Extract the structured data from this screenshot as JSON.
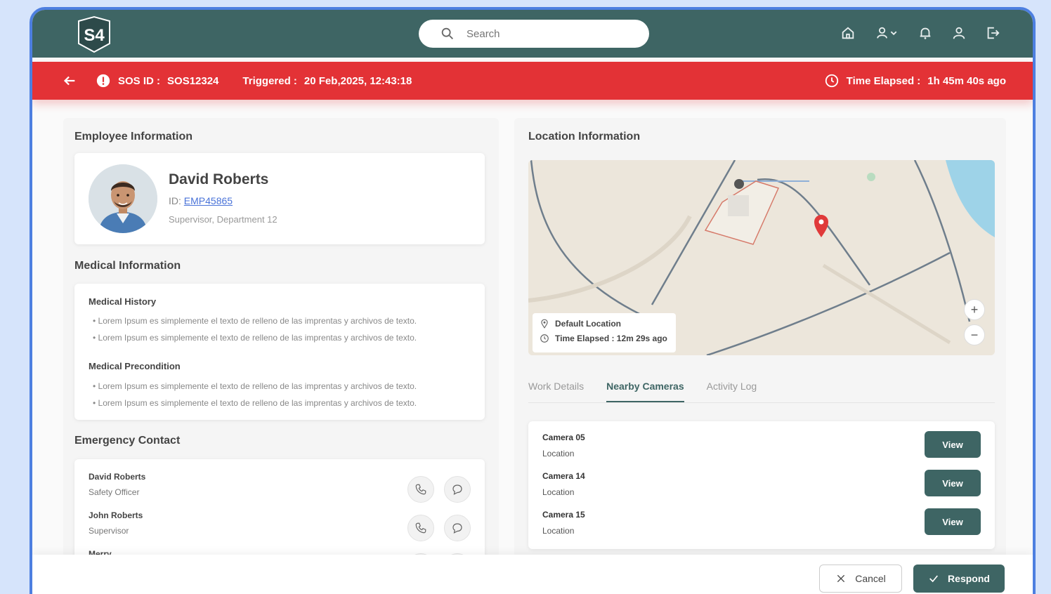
{
  "header": {
    "logo_text": "S4",
    "search_placeholder": "Search",
    "icons": [
      "home-icon",
      "users-dropdown-icon",
      "bell-icon",
      "user-icon",
      "logout-icon"
    ]
  },
  "sos": {
    "id_label": "SOS ID :",
    "id_value": "SOS12324",
    "triggered_label": "Triggered :",
    "triggered_value": "20 Feb,2025, 12:43:18",
    "elapsed_label": "Time Elapsed :",
    "elapsed_value": "1h 45m 40s ago"
  },
  "employee": {
    "section_title": "Employee Information",
    "name": "David Roberts",
    "id_prefix": "ID:",
    "id_value": "EMP45865",
    "role": "Supervisor, Department 12"
  },
  "medical": {
    "section_title": "Medical Information",
    "history_title": "Medical History",
    "history_items": [
      "Lorem Ipsum es simplemente el texto de relleno de las imprentas y archivos de texto.",
      "Lorem Ipsum es simplemente el texto de relleno de las imprentas y archivos de texto."
    ],
    "precondition_title": "Medical Precondition",
    "precondition_items": [
      "Lorem Ipsum es simplemente el texto de relleno de las imprentas y archivos de texto.",
      "Lorem Ipsum es simplemente el texto de relleno de las imprentas y archivos de texto."
    ]
  },
  "emergency": {
    "section_title": "Emergency Contact",
    "contacts": [
      {
        "name": "David Roberts",
        "role": "Safety Officer"
      },
      {
        "name": "John Roberts",
        "role": "Supervisor"
      },
      {
        "name": "Merry",
        "role": ""
      }
    ]
  },
  "location": {
    "section_title": "Location Information",
    "map_label": "Default Location",
    "map_time": "Time Elapsed : 12m 29s ago",
    "zoom_in": "+",
    "zoom_out": "−"
  },
  "tabs": [
    "Work Details",
    "Nearby Cameras",
    "Activity Log"
  ],
  "active_tab": "Nearby Cameras",
  "cameras": [
    {
      "name": "Camera 05",
      "location": "Location",
      "action": "View"
    },
    {
      "name": "Camera 14",
      "location": "Location",
      "action": "View"
    },
    {
      "name": "Camera 15",
      "location": "Location",
      "action": "View"
    }
  ],
  "footer": {
    "cancel_label": "Cancel",
    "respond_label": "Respond"
  },
  "colors": {
    "primary": "#3e6564",
    "alert": "#e33236",
    "frame_border": "#4d7fe0",
    "pin": "#e03a3a"
  }
}
